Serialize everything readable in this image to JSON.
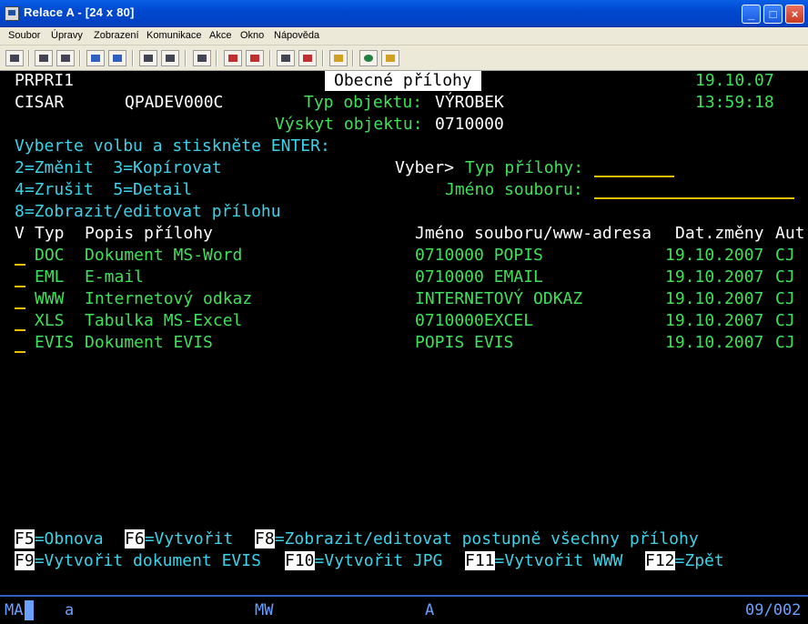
{
  "window": {
    "title": "Relace A - [24 x 80]",
    "minimize_icon": "minimize-icon",
    "maximize_icon": "maximize-icon",
    "close_icon": "close-icon"
  },
  "menu": {
    "items": [
      "Soubor",
      "Úpravy",
      "Zobrazení",
      "Komunikace",
      "Akce",
      "Okno",
      "Nápověda"
    ]
  },
  "terminal": {
    "program": "PRPRI1",
    "screen_title": "Obecné přílohy",
    "date": "19.10.07",
    "user": "CISAR",
    "device": "QPADEV000C",
    "object_type_label": "Typ objektu:",
    "object_type_value": "VÝROBEK",
    "time": "13:59:18",
    "occurrence_label": "Výskyt objektu:",
    "occurrence_value": "0710000",
    "instruction": "Vyberte volbu a stiskněte ENTER:",
    "options": [
      "2=Změnit  3=Kopírovat",
      "4=Zrušit  5=Detail",
      "8=Zobrazit/editovat přílohu"
    ],
    "filter": {
      "select_label": "Vyber>",
      "type_label": "Typ přílohy:",
      "type_value": "",
      "filename_label": "Jméno souboru:",
      "filename_value": ""
    },
    "columns": {
      "v": "V",
      "typ": "Typ",
      "popis": "Popis přílohy",
      "soubor": "Jméno souboru/www-adresa",
      "datum": "Dat.změny",
      "autor": "Aut"
    },
    "rows": [
      {
        "typ": "DOC",
        "popis": "Dokument MS-Word",
        "soubor": "0710000 POPIS",
        "datum": "19.10.2007",
        "autor": "CJ"
      },
      {
        "typ": "EML",
        "popis": "E-mail",
        "soubor": "0710000 EMAIL",
        "datum": "19.10.2007",
        "autor": "CJ"
      },
      {
        "typ": "WWW",
        "popis": "Internetový odkaz",
        "soubor": "INTERNETOVÝ ODKAZ",
        "datum": "19.10.2007",
        "autor": "CJ"
      },
      {
        "typ": "XLS",
        "popis": "Tabulka MS-Excel",
        "soubor": "0710000EXCEL",
        "datum": "19.10.2007",
        "autor": "CJ"
      },
      {
        "typ": "EVIS",
        "popis": "Dokument EVIS",
        "soubor": "POPIS EVIS",
        "datum": "19.10.2007",
        "autor": "CJ"
      }
    ],
    "fkeys_row1": [
      {
        "key": "F5",
        "label": "=Obnova"
      },
      {
        "key": "F6",
        "label": "=Vytvořit"
      },
      {
        "key": "F8",
        "label": "=Zobrazit/editovat postupně všechny přílohy"
      }
    ],
    "fkeys_row2": [
      {
        "key": "F9",
        "label": "=Vytvořit dokument EVIS"
      },
      {
        "key": "F10",
        "label": "=Vytvořit JPG"
      },
      {
        "key": "F11",
        "label": "=Vytvořit WWW"
      },
      {
        "key": "F12",
        "label": "=Zpět"
      }
    ]
  },
  "status": {
    "indicator": "MA",
    "field_a": "a",
    "mode": "MW",
    "field_A": "A",
    "position": "09/002"
  }
}
